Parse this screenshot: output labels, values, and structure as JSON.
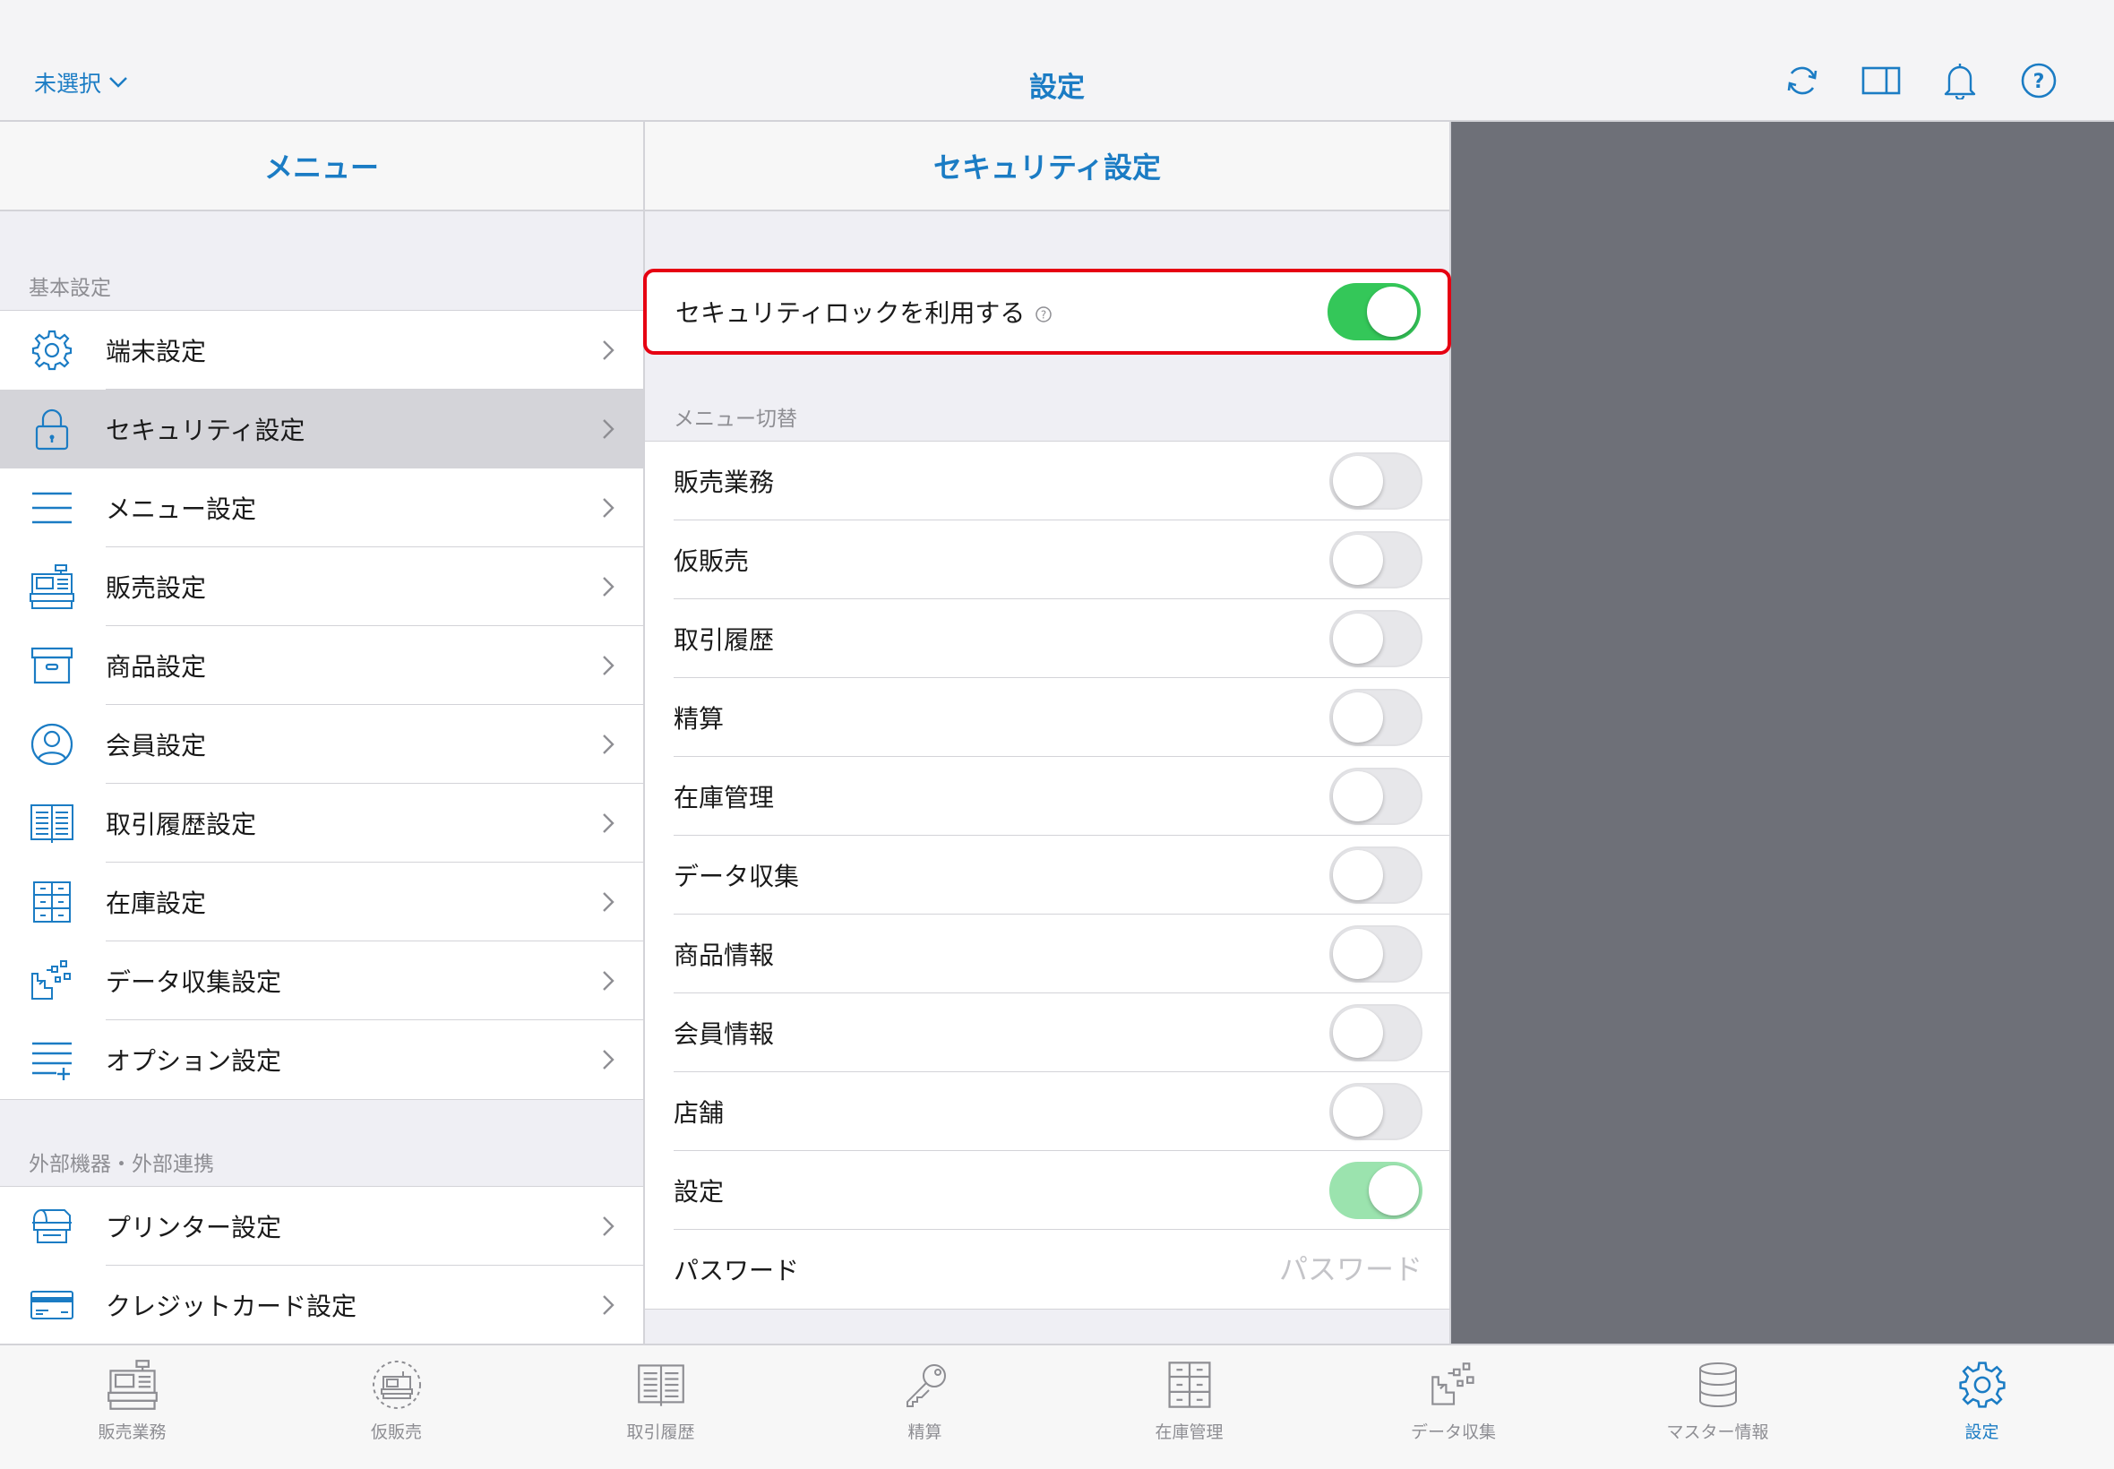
{
  "header": {
    "store_select": "未選択",
    "title": "設定",
    "icons": [
      "sync-icon",
      "split-view-icon",
      "bell-icon",
      "help-icon"
    ]
  },
  "menu": {
    "title": "メニュー",
    "section_basic": "基本設定",
    "items": [
      {
        "label": "端末設定",
        "icon": "gear-icon"
      },
      {
        "label": "セキュリティ設定",
        "icon": "lock-icon",
        "selected": true
      },
      {
        "label": "メニュー設定",
        "icon": "menu-lines-icon"
      },
      {
        "label": "販売設定",
        "icon": "register-icon"
      },
      {
        "label": "商品設定",
        "icon": "box-icon"
      },
      {
        "label": "会員設定",
        "icon": "user-icon"
      },
      {
        "label": "取引履歴設定",
        "icon": "book-icon"
      },
      {
        "label": "在庫設定",
        "icon": "shelves-icon"
      },
      {
        "label": "データ収集設定",
        "icon": "data-collect-icon"
      },
      {
        "label": "オプション設定",
        "icon": "options-icon"
      }
    ],
    "section_external": "外部機器・外部連携",
    "external_items": [
      {
        "label": "プリンター設定",
        "icon": "printer-icon"
      },
      {
        "label": "クレジットカード設定",
        "icon": "credit-card-icon"
      }
    ]
  },
  "detail": {
    "title": "セキュリティ設定",
    "security_lock_label": "セキュリティロックを利用する",
    "security_lock_on": true,
    "section_menu_switch": "メニュー切替",
    "toggles": [
      {
        "label": "販売業務",
        "state": "off"
      },
      {
        "label": "仮販売",
        "state": "off"
      },
      {
        "label": "取引履歴",
        "state": "off"
      },
      {
        "label": "精算",
        "state": "off"
      },
      {
        "label": "在庫管理",
        "state": "off"
      },
      {
        "label": "データ収集",
        "state": "off"
      },
      {
        "label": "商品情報",
        "state": "off"
      },
      {
        "label": "会員情報",
        "state": "off"
      },
      {
        "label": "店舗",
        "state": "off"
      },
      {
        "label": "設定",
        "state": "on-disabled"
      }
    ],
    "password_label": "パスワード",
    "password_placeholder": "パスワード"
  },
  "tabbar": {
    "tabs": [
      {
        "label": "販売業務",
        "icon": "register-icon"
      },
      {
        "label": "仮販売",
        "icon": "temp-register-icon"
      },
      {
        "label": "取引履歴",
        "icon": "book-icon"
      },
      {
        "label": "精算",
        "icon": "key-icon"
      },
      {
        "label": "在庫管理",
        "icon": "shelves-icon"
      },
      {
        "label": "データ収集",
        "icon": "data-collect-icon"
      },
      {
        "label": "マスター情報",
        "icon": "database-icon"
      },
      {
        "label": "設定",
        "icon": "gear-icon",
        "active": true
      }
    ]
  },
  "colors": {
    "accent": "#1b7cc4",
    "toggle_on": "#34c759",
    "highlight_border": "#e60012",
    "right_area": "#6e7078"
  }
}
